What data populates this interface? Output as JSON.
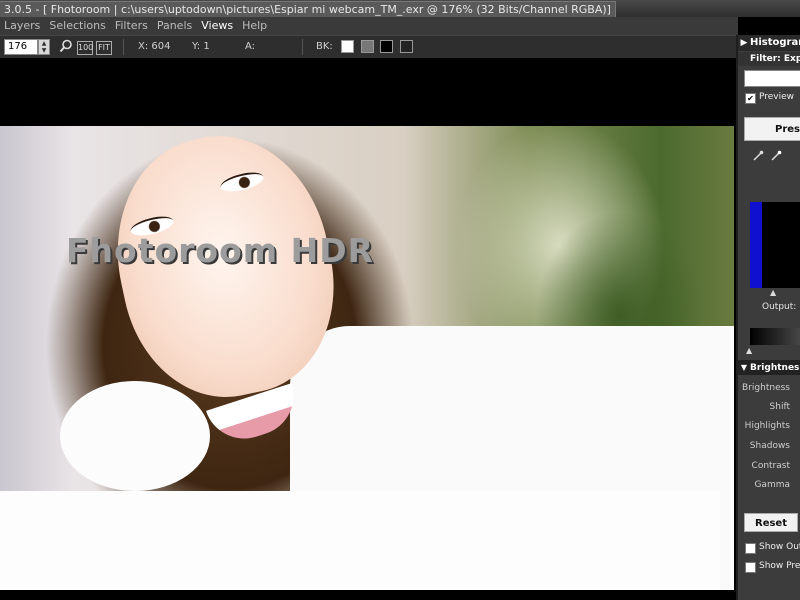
{
  "window": {
    "title": "3.0.5 - [  Fhotoroom | c:\\users\\uptodown\\pictures\\Espiar mi webcam_TM_.exr @ 176% (32 Bits/Channel RGBA)]"
  },
  "menu": {
    "items": [
      "Layers",
      "Selections",
      "Filters",
      "Panels",
      "Views",
      "Help"
    ]
  },
  "toolbar": {
    "zoom_value": "176",
    "zoom_icon": "magnifier-icon",
    "fit_100_label": "100",
    "fit_label": "FIT",
    "x_readout": "X: 604",
    "y_readout": "Y: 1",
    "a_readout": "A:",
    "bk_label": "BK:",
    "bk_swatches": [
      "#ffffff",
      "#777777",
      "#000000",
      "#222222"
    ]
  },
  "canvas": {
    "watermark": "Fhotoroom HDR"
  },
  "panel": {
    "histogram_header": "Histogram",
    "filter_header": "Filter: Expo",
    "preview_label": "Preview",
    "preview_checked": true,
    "preset_button": "Pres",
    "output_label": "Output:",
    "brightness_header": "Brightnes",
    "sliders": [
      "Brightness",
      "Shift",
      "Highlights",
      "Shadows",
      "Contrast",
      "Gamma"
    ],
    "reset_button": "Reset",
    "show_out_label": "Show Out o",
    "show_pres_label": "Show Pres"
  }
}
